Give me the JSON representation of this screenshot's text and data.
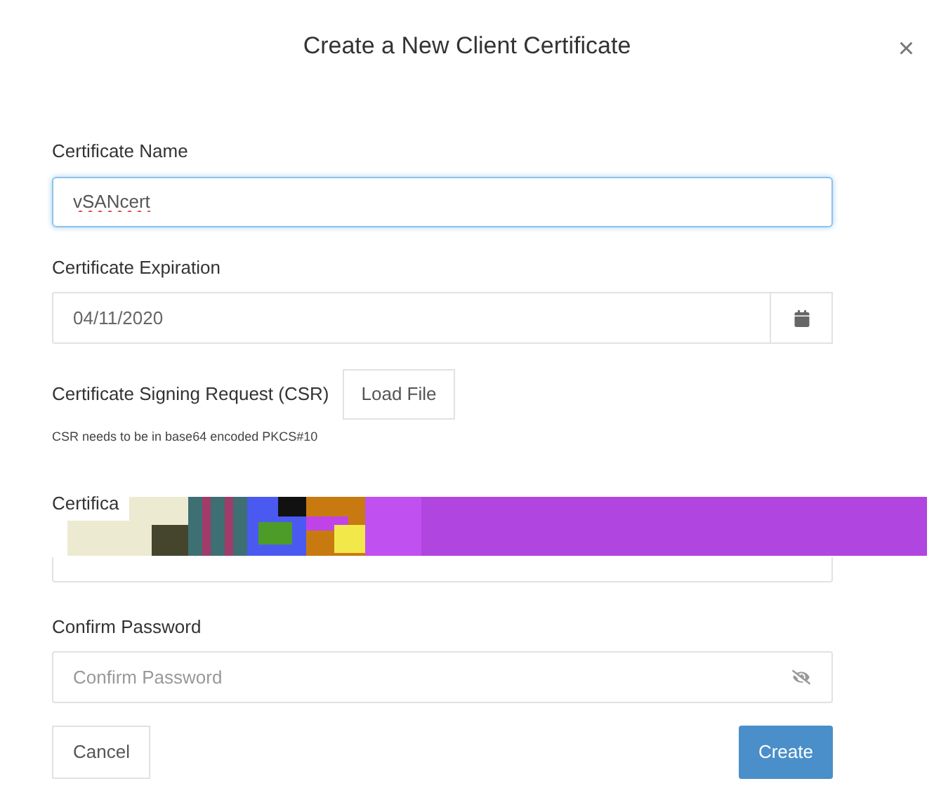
{
  "dialog": {
    "title": "Create a New Client Certificate",
    "close": "×"
  },
  "name_field": {
    "label": "Certificate Name",
    "value": "vSANcert",
    "focused": true
  },
  "expiration_field": {
    "label": "Certificate Expiration",
    "value": "04/11/2020"
  },
  "csr": {
    "label": "Certificate Signing Request (CSR)",
    "button": "Load File",
    "hint": "CSR needs to be in base64 encoded PKCS#10"
  },
  "password_field": {
    "label": "Certifica"
  },
  "confirm_field": {
    "label": "Confirm Password",
    "placeholder": "Confirm Password"
  },
  "buttons": [
    {
      "label": "Cancel",
      "kind": "secondary"
    },
    {
      "label": "Create",
      "kind": "primary"
    }
  ]
}
